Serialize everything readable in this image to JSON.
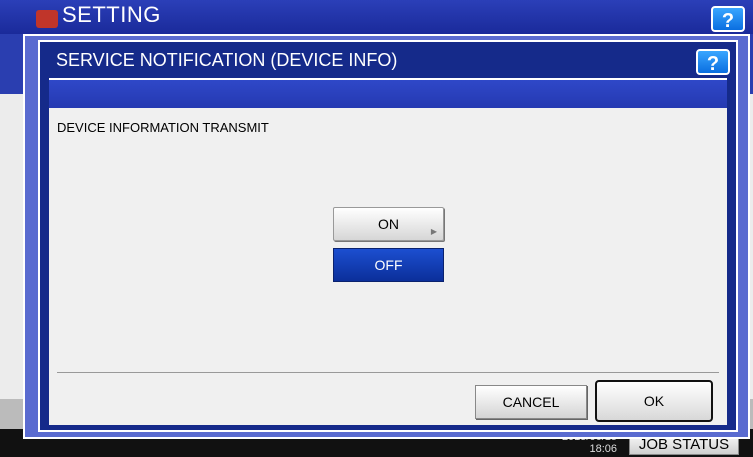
{
  "background": {
    "title": "SETTING",
    "help_label": "?",
    "datetime_date": "2015/06/15",
    "datetime_time": "18:06",
    "job_status_label": "JOB STATUS"
  },
  "dialog": {
    "title": "SERVICE NOTIFICATION (DEVICE INFO)",
    "help_label": "?",
    "section_label": "DEVICE INFORMATION TRANSMIT",
    "options": [
      {
        "label": "ON",
        "selected": false
      },
      {
        "label": "OFF",
        "selected": true
      }
    ],
    "cancel_label": "CANCEL",
    "ok_label": "OK"
  }
}
